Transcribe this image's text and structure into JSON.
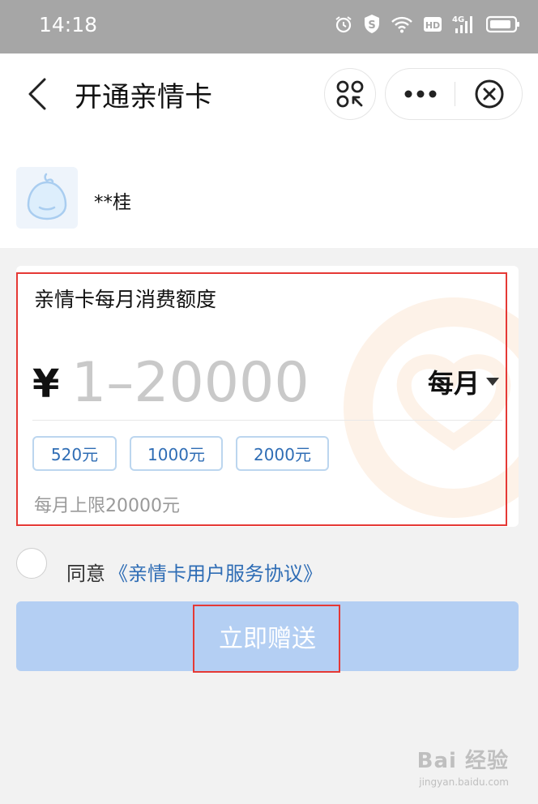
{
  "status_bar": {
    "time": "14:18",
    "icons": [
      "alarm-icon",
      "shield-s-icon",
      "wifi-icon",
      "hd-icon",
      "4g-signal-icon",
      "battery-icon"
    ],
    "hd_label": "HD",
    "network_label": "4G"
  },
  "nav": {
    "title": "开通亲情卡",
    "icons": [
      "back-arrow-icon",
      "scan-icon",
      "more-dots-icon",
      "close-circle-icon"
    ]
  },
  "user": {
    "name": "**桂"
  },
  "amount_card": {
    "title": "亲情卡每月消费额度",
    "currency": "¥",
    "input_value": "",
    "input_placeholder": "1–20000",
    "period": "每月",
    "quick_amounts": [
      "520元",
      "1000元",
      "2000元"
    ],
    "limit_note": "每月上限20000元"
  },
  "agreement": {
    "prefix": "同意",
    "link": "《亲情卡用户服务协议》",
    "checked": false
  },
  "submit": {
    "label": "立即赠送"
  },
  "watermark": {
    "brand": "Bai 经验",
    "sub": "jingyan.baidu.com"
  },
  "colors": {
    "status_bar": "#a6a6a6",
    "link": "#2f6db5",
    "button_disabled": "#b4cff3",
    "highlight": "#e53935",
    "chip_border": "#bcd6ef"
  }
}
